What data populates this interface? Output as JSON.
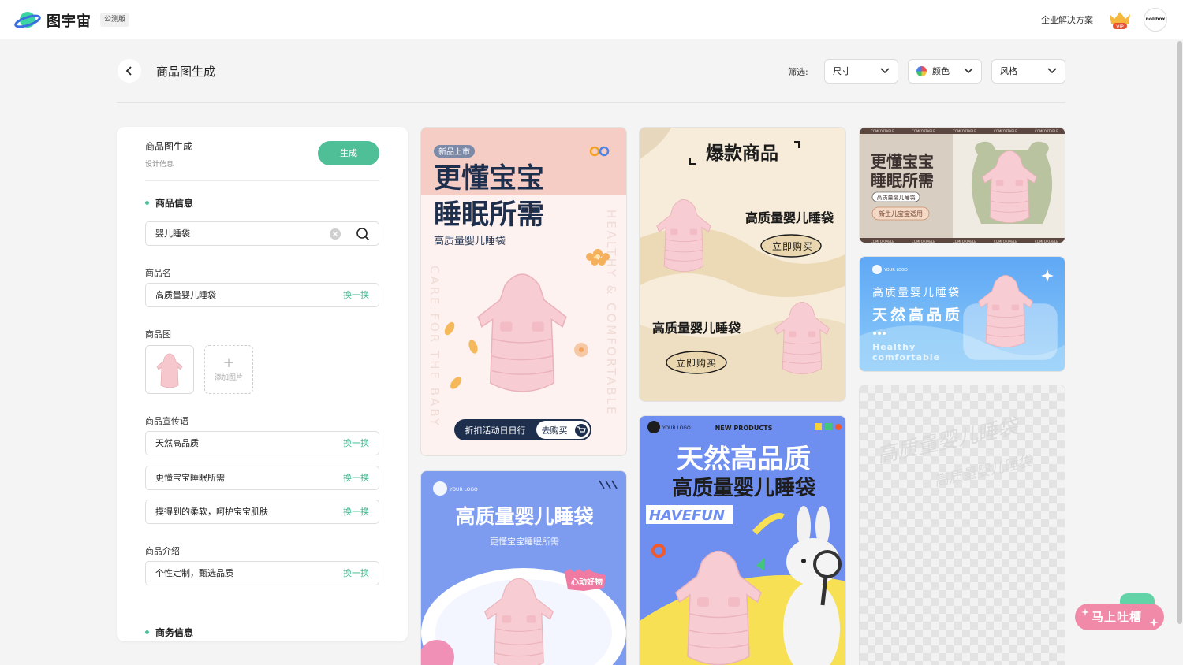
{
  "app": {
    "name": "图宇宙",
    "badge": "公测版",
    "enterprise": "企业解决方案",
    "vip_label": "VIP",
    "avatar_text": "nolibox"
  },
  "page": {
    "title": "商品图生成",
    "filter_label": "筛选:",
    "filters": [
      {
        "label": "尺寸"
      },
      {
        "label": "颜色"
      },
      {
        "label": "风格"
      }
    ]
  },
  "panel": {
    "title": "商品图生成",
    "subtitle": "设计信息",
    "generate": "生成",
    "section_product": "商品信息",
    "search_value": "婴儿睡袋",
    "name_label": "商品名",
    "name_value": "高质量婴儿睡袋",
    "swap": "换一换",
    "image_label": "商品图",
    "add_image": "添加图片",
    "slogan_label": "商品宣传语",
    "slogans": [
      "天然高品质",
      "更懂宝宝睡眠所需",
      "摸得到的柔软，呵护宝宝肌肤"
    ],
    "intro_label": "商品介绍",
    "intro_value": "个性定制，甄选品质",
    "section_business": "商务信息"
  },
  "posters": {
    "p1": {
      "badge": "新品上市",
      "title1": "更懂宝宝",
      "title2": "睡眠所需",
      "subtitle": "高质量婴儿睡袋",
      "vertical1": "HEALTHY & COMFORTABLE",
      "vertical2": "CARE FOR THE BABY",
      "cta_left": "折扣活动日日行",
      "cta_right": "去购买"
    },
    "p2": {
      "title": "爆款商品",
      "product": "高质量婴儿睡袋",
      "buy": "立即购买"
    },
    "p3": {
      "strip": "COMFORTABLE",
      "title1": "更懂宝宝",
      "title2": "睡眠所需",
      "tag": "高质量婴儿睡袋",
      "pill": "新生儿宝宝适用"
    },
    "p4": {
      "logo": "YOUR LOGO",
      "line1": "高质量婴儿睡袋",
      "line2": "天然高品质",
      "en1": "Healthy",
      "en2": "comfortable"
    },
    "p5": {
      "logo": "YOUR LOGO",
      "title": "高质量婴儿睡袋",
      "subtitle": "更懂宝宝睡眠所需",
      "bubble": "心动好物"
    },
    "p6": {
      "logo": "YOUR LOGO",
      "tag": "NEW PRODUCTS",
      "title1": "天然高品质",
      "title2": "高质量婴儿睡袋",
      "brand": "HAVEFUN"
    },
    "p7": {
      "wm1": "高质量婴儿睡袋",
      "wm2": "高质量婴儿睡袋"
    }
  },
  "feedback": "马上吐槽"
}
